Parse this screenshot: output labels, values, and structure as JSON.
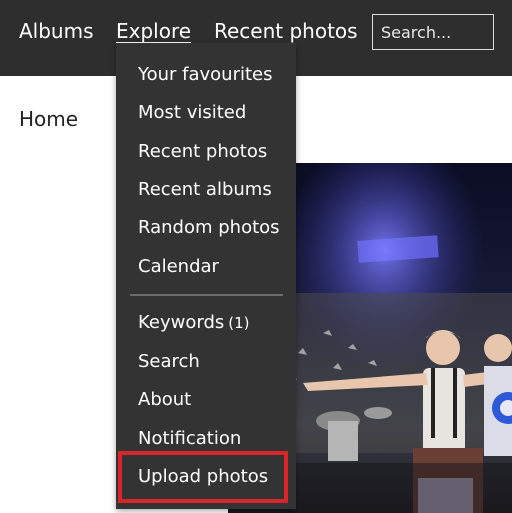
{
  "nav": {
    "albums": "Albums",
    "explore": "Explore",
    "recent_photos": "Recent photos"
  },
  "search": {
    "placeholder": "Search..."
  },
  "breadcrumb": {
    "home": "Home"
  },
  "explore_menu": {
    "items": [
      {
        "label": "Your favourites"
      },
      {
        "label": "Most visited"
      },
      {
        "label": "Recent photos"
      },
      {
        "label": "Recent albums"
      },
      {
        "label": "Random photos"
      },
      {
        "label": "Calendar"
      },
      {
        "label": "Keywords",
        "count": "(1)"
      },
      {
        "label": "Search"
      },
      {
        "label": "About"
      },
      {
        "label": "Notification"
      },
      {
        "label": "Upload photos",
        "highlighted": true
      }
    ]
  },
  "colors": {
    "topbar": "#2e2e2e",
    "dropdown": "#333333",
    "highlight_border": "#d6262a"
  }
}
